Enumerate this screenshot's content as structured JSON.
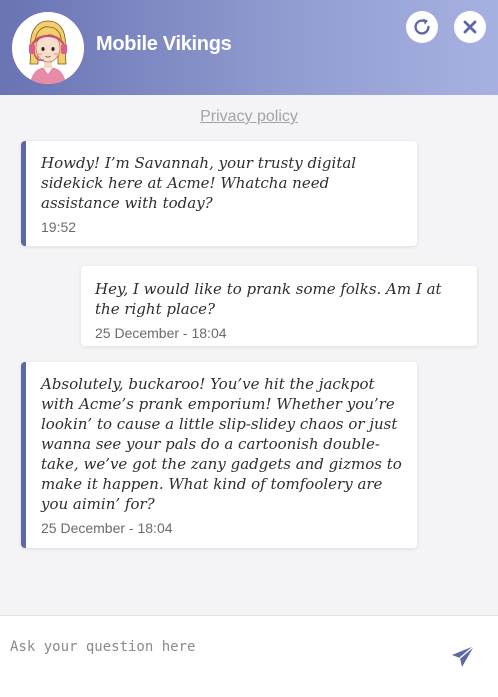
{
  "header": {
    "title": "Mobile Vikings",
    "refresh_icon": "refresh-icon",
    "close_icon": "close-icon"
  },
  "privacy_link": "Privacy policy",
  "messages": [
    {
      "sender": "bot",
      "text": "Howdy! I’m Savannah, your trusty digital sidekick here at Acme! Whatcha need assistance with today?",
      "time": "19:52"
    },
    {
      "sender": "user",
      "text": "Hey, I would like to prank some folks. Am I at the right place?",
      "time": "25 December - 18:04"
    },
    {
      "sender": "bot",
      "text": "Absolutely, buckaroo! You’ve hit the jackpot with Acme’s prank emporium! Whether you’re lookin’ to cause a little slip-slidey chaos or just wanna see your pals do a cartoonish double-take, we’ve got the zany gadgets and gizmos to make it happen. What kind of tomfoolery are you aimin’ for?",
      "time": "25 December - 18:04"
    }
  ],
  "input": {
    "placeholder": "Ask your question here",
    "value": ""
  },
  "colors": {
    "header_start": "#6a73b3",
    "header_end": "#a7b1e1",
    "bot_accent": "#5f67a8",
    "send_icon": "#5f67a8"
  }
}
